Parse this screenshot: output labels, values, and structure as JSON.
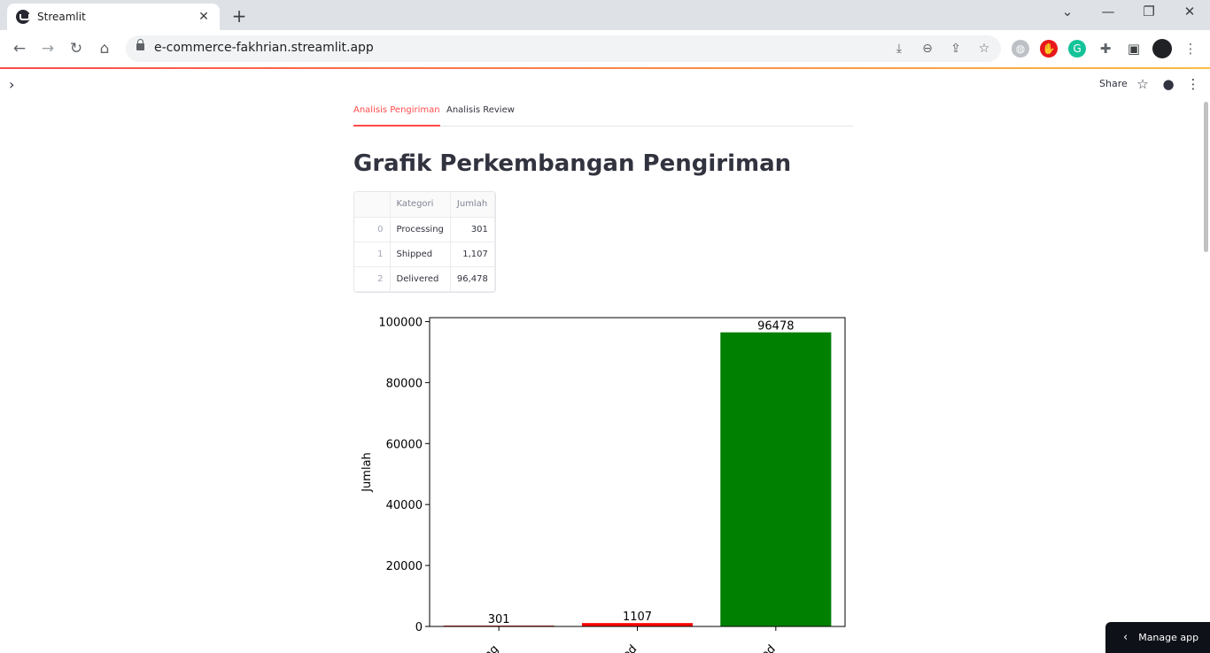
{
  "browser": {
    "tab_title": "Streamlit",
    "url": "e-commerce-fakhrian.streamlit.app",
    "tab_close": "✕",
    "new_tab": "+"
  },
  "header": {
    "share_label": "Share"
  },
  "tabs": [
    {
      "label": "Analisis Pengiriman",
      "active": true
    },
    {
      "label": "Analisis Review",
      "active": false
    }
  ],
  "page_title": "Grafik Perkembangan Pengiriman",
  "dataframe": {
    "columns": [
      "",
      "Kategori",
      "Jumlah"
    ],
    "rows": [
      {
        "index": "0",
        "kategori": "Processing",
        "jumlah": "301"
      },
      {
        "index": "1",
        "kategori": "Shipped",
        "jumlah": "1,107"
      },
      {
        "index": "2",
        "kategori": "Delivered",
        "jumlah": "96,478"
      }
    ]
  },
  "chart_data": {
    "type": "bar",
    "categories": [
      "Processing",
      "Shipped",
      "Delivered"
    ],
    "visible_tick_labels": [
      "sing",
      "ped",
      "ered"
    ],
    "values": [
      301,
      1107,
      96478
    ],
    "colors": [
      "#d62728",
      "#ff0000",
      "#008000"
    ],
    "ylabel": "Jumlah",
    "xlabel": "",
    "ylim": [
      0,
      101300
    ],
    "yticks": [
      0,
      20000,
      40000,
      60000,
      80000,
      100000
    ],
    "data_labels": [
      "301",
      "1107",
      "96478"
    ]
  },
  "manage_app": {
    "label": "Manage app"
  },
  "colors": {
    "accent": "#ff4b4b",
    "text": "#31333f"
  }
}
